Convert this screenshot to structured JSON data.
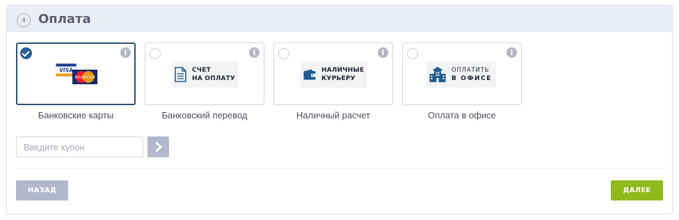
{
  "section": {
    "step_number": "4",
    "title": "Оплата"
  },
  "payment_options": [
    {
      "label": "Банковские карты",
      "selected": true,
      "logo": {
        "visa": "VISA",
        "mastercard": "MasterCard"
      }
    },
    {
      "label": "Банковский перевод",
      "selected": false,
      "logo": {
        "line1": "СЧЕТ",
        "line2": "НА ОПЛАТУ"
      }
    },
    {
      "label": "Наличный расчет",
      "selected": false,
      "logo": {
        "line1": "НАЛИЧНЫЕ",
        "line2": "КУРЬЕРУ"
      }
    },
    {
      "label": "Оплата в офисе",
      "selected": false,
      "logo": {
        "line1": "ОПЛАТИТЬ",
        "line2": "В ОФИСЕ"
      }
    }
  ],
  "coupon": {
    "value": "",
    "placeholder": "Введите купон"
  },
  "buttons": {
    "back": "НАЗАД",
    "next": "ДАЛЕЕ"
  },
  "colors": {
    "header_bg": "#ebedf7",
    "selected_border": "#2e4f74",
    "next_button": "#8fba1f",
    "back_button": "#b4b8cc"
  },
  "icons": {
    "info": "info-icon",
    "checkmark": "check-icon",
    "coupon_submit": "chevron-right-icon",
    "bank_transfer": "document-icon",
    "courier_cash": "wallet-icon",
    "office": "office-building-icon"
  }
}
